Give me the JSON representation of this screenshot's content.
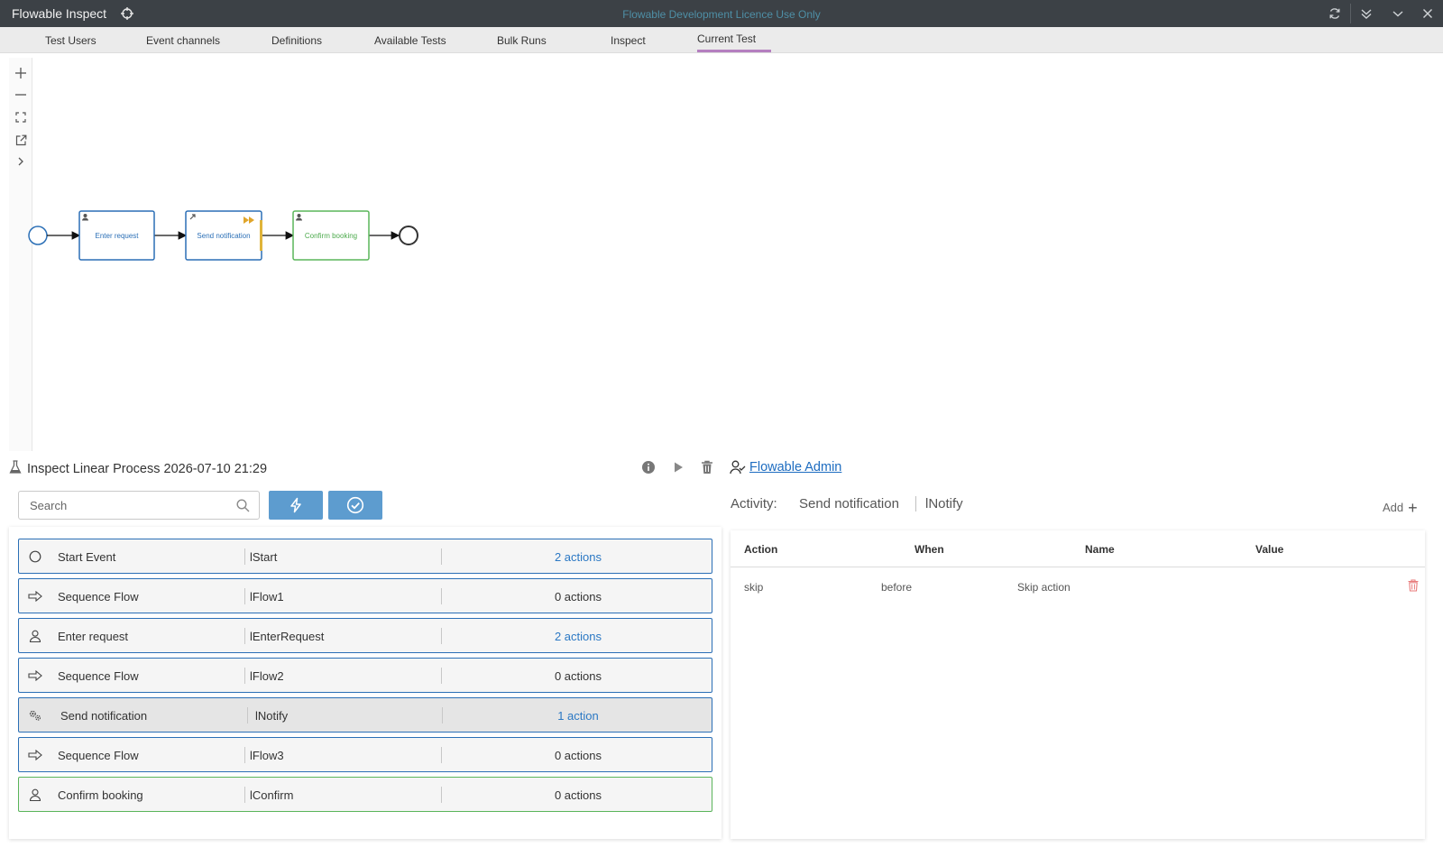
{
  "window": {
    "title": "Flowable Inspect",
    "licence_notice": "Flowable Development Licence Use Only"
  },
  "tabs": [
    {
      "label": "Test Users"
    },
    {
      "label": "Event channels"
    },
    {
      "label": "Definitions"
    },
    {
      "label": "Available Tests"
    },
    {
      "label": "Bulk Runs"
    },
    {
      "label": "Inspect"
    },
    {
      "label": "Current Test",
      "active": true
    }
  ],
  "diagram": {
    "tasks": [
      {
        "label": "Enter request",
        "state": "completed"
      },
      {
        "label": "Send notification",
        "state": "current"
      },
      {
        "label": "Confirm booking",
        "state": "pending"
      }
    ]
  },
  "test": {
    "title": "Inspect Linear Process 2026-07-10 21:29",
    "search_placeholder": "Search"
  },
  "elements": [
    {
      "type": "Start Event",
      "id": "lStart",
      "actions": "2 actions",
      "icon": "circle-icon",
      "has_actions": true
    },
    {
      "type": "Sequence Flow",
      "id": "lFlow1",
      "actions": "0 actions",
      "icon": "arrow-right-icon",
      "has_actions": false
    },
    {
      "type": "Enter request",
      "id": "lEnterRequest",
      "actions": "2 actions",
      "icon": "user-icon",
      "has_actions": true
    },
    {
      "type": "Sequence Flow",
      "id": "lFlow2",
      "actions": "0 actions",
      "icon": "arrow-right-icon",
      "has_actions": false
    },
    {
      "type": "Send notification",
      "id": "lNotify",
      "actions": "1 action",
      "icon": "gears-icon",
      "has_actions": true,
      "selected": true
    },
    {
      "type": "Sequence Flow",
      "id": "lFlow3",
      "actions": "0 actions",
      "icon": "arrow-right-icon",
      "has_actions": false
    },
    {
      "type": "Confirm booking",
      "id": "lConfirm",
      "actions": "0 actions",
      "icon": "user-icon",
      "has_actions": false
    }
  ],
  "user": {
    "name": "Flowable Admin"
  },
  "activity": {
    "label": "Activity:",
    "name": "Send notification",
    "id": "lNotify",
    "add_label": "Add"
  },
  "actions_table": {
    "columns": [
      "Action",
      "When",
      "Name",
      "Value"
    ],
    "rows": [
      {
        "action": "skip",
        "when": "before",
        "name": "Skip action",
        "value": ""
      }
    ]
  },
  "colors": {
    "accent": "#5d9ccf",
    "tab_underline": "#b57fc0",
    "link": "#2b78c4",
    "task_border_done": "#2b6fb6",
    "task_border_pending": "#5ab55a",
    "delete": "#e87b7b"
  }
}
